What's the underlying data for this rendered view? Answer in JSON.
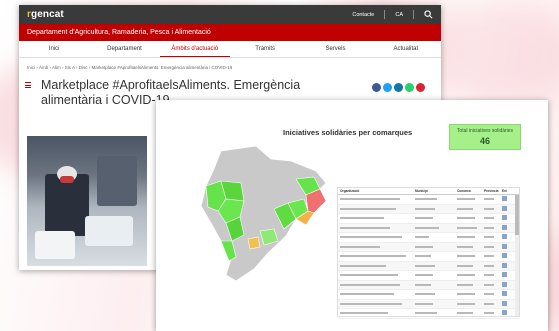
{
  "gencat": {
    "logo_prefix": "r",
    "logo_name": "gencat",
    "contact": "Contacte",
    "lang": "CA",
    "department": "Departament d'Agricultura, Ramaderia, Pesca i Alimentació",
    "menu": [
      "Inici",
      "Departament",
      "Àmbits d'actuació",
      "Tràmits",
      "Serveis",
      "Actualitat"
    ],
    "breadcrumb": "Inici  ›  Àmb  ›  Alim  ›  Sis A  ›  Disc  ›  Marketplace #AprofitaelsAliments. Emergència alimentària i COVID-19",
    "page_title": "Marketplace #AprofitaelsAliments. Emergència alimentària i COVID-19"
  },
  "initiatives": {
    "title": "Iniciatives solidàries per comarques",
    "kpi_label": "Total iniciatives solidàries",
    "kpi_value": "46",
    "columns": [
      "Organització",
      "Municipi",
      "Comarca",
      "Província",
      "Enl"
    ]
  }
}
